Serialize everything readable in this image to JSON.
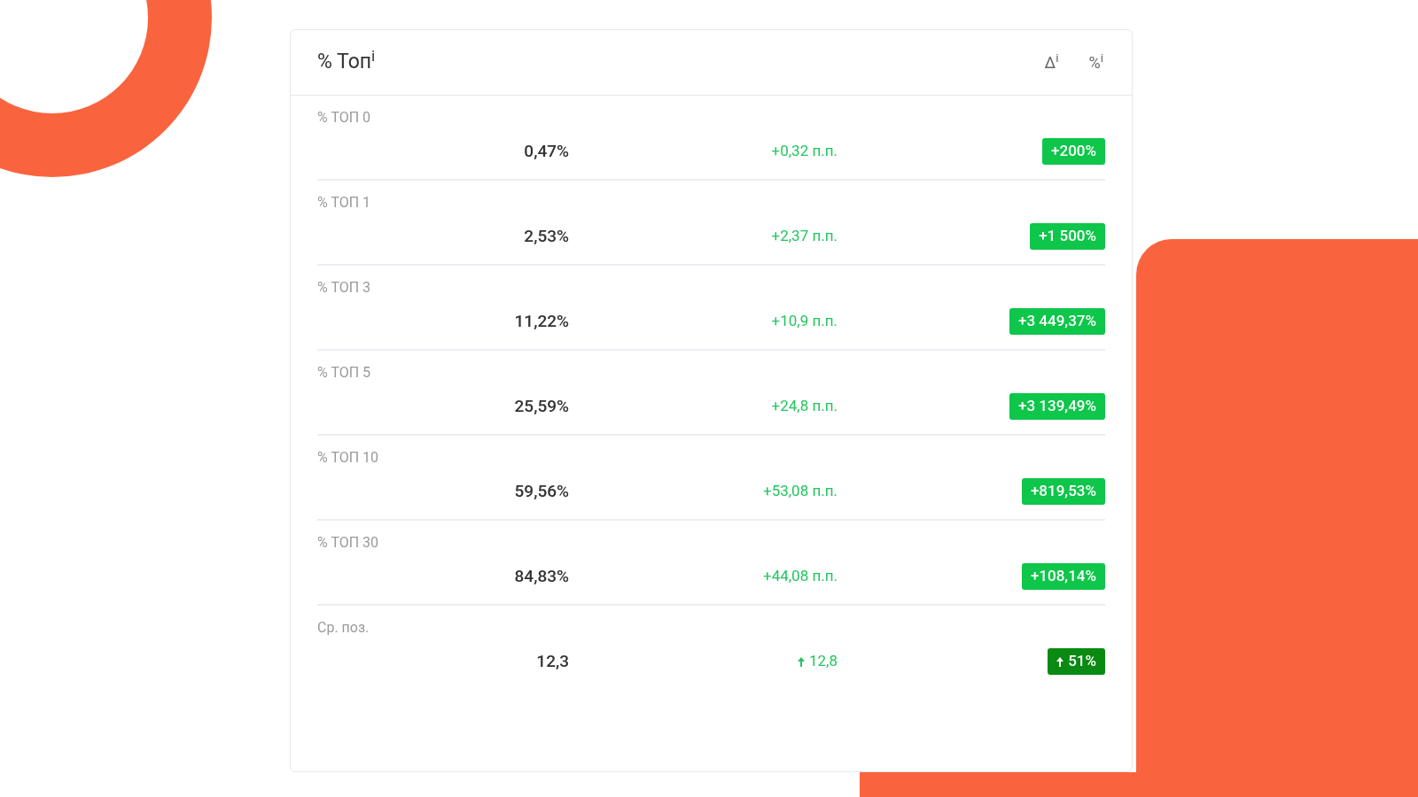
{
  "header": {
    "title": "% Топ$^{i}$",
    "columns": [
      "Δ$^{i}$",
      "%$^{i}$"
    ]
  },
  "rows": [
    {
      "kind": "percent",
      "label": "% ТОП 0",
      "value": "0,47%",
      "delta": "+0,32 п.п.",
      "change": "+200%"
    },
    {
      "kind": "percent",
      "label": "% ТОП 1",
      "value": "2,53%",
      "delta": "+2,37 п.п.",
      "change": "+1 500%"
    },
    {
      "kind": "percent",
      "label": "% ТОП 3",
      "value": "11,22%",
      "delta": "+10,9 п.п.",
      "change": "+3 449,37%"
    },
    {
      "kind": "percent",
      "label": "% ТОП 5",
      "value": "25,59%",
      "delta": "+24,8 п.п.",
      "change": "+3 139,49%"
    },
    {
      "kind": "percent",
      "label": "% ТОП 10",
      "value": "59,56%",
      "delta": "+53,08 п.п.",
      "change": "+819,53%"
    },
    {
      "kind": "percent",
      "label": "% ТОП 30",
      "value": "84,83%",
      "delta": "+44,08 п.п.",
      "change": "+108,14%"
    },
    {
      "kind": "arrow",
      "label": "Ср. поз.",
      "value": "12,3",
      "delta": "12,8",
      "change": "51%"
    }
  ]
}
